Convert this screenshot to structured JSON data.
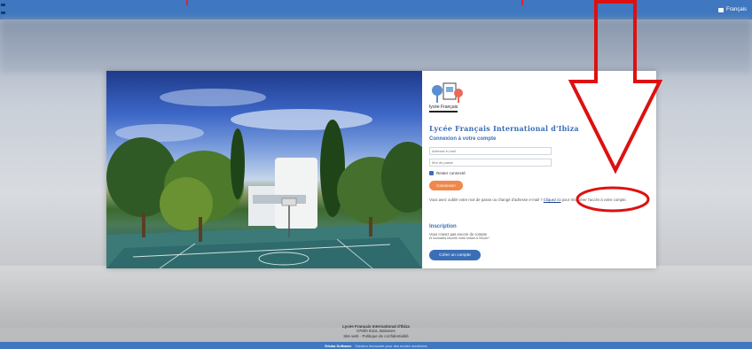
{
  "topbar": {
    "language": "Français"
  },
  "login": {
    "logo_caption": "lycée Français",
    "school_name": "Lycée Français International d'Ibiza",
    "connexion_title": "Connexion à votre compte",
    "email_placeholder": "Adresse e-mail",
    "password_placeholder": "Mot de passe",
    "remember_label": "Rester connecté",
    "connect_button": "Connexion",
    "forgot_text_before": "Vous avez oublié votre mot de passe ou changé d'adresse e-mail ? ",
    "forgot_link": "Cliquez ici",
    "forgot_text_after": " pour récupérer l'accès à votre compte.",
    "signup_title": "Inscription",
    "signup_line1": "Vous n'avez pas encore de compte",
    "signup_line2": "et souhaitez inscrire votre enfant à l'école?",
    "create_button": "Créer un compte"
  },
  "footer": {
    "school": "Lycée Français International d'Ibiza",
    "address": "07800 Ibiza, Baleares",
    "links": "Site web · Politique de confidentialité",
    "brand": "Eduka Software",
    "tagline": "Solution innovante pour des écoles modernes"
  },
  "colors": {
    "topbar": "#3f78c0",
    "title_blue": "#3b6fb5",
    "connect_orange": "#f0874b",
    "annotation_red": "#dd1111"
  },
  "icons": [
    "flag-icon",
    "school-logo-icon",
    "checkbox-icon",
    "arrow-annotation",
    "ellipse-annotation"
  ]
}
